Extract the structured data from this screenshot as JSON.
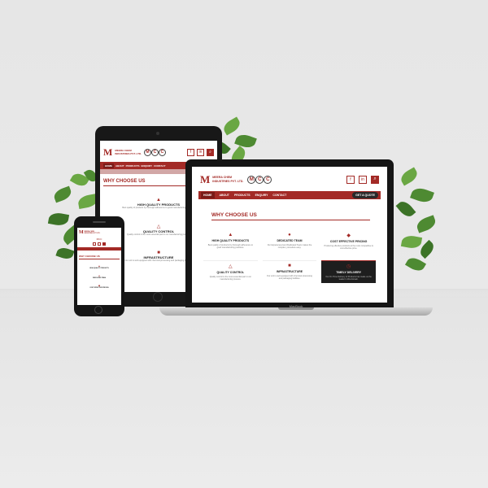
{
  "brand": {
    "logo_letter": "M",
    "company_line1": "MEERA CHEM",
    "company_line2": "INDUSTRIES PVT. LTD.",
    "mcc": [
      "M",
      "C",
      "C"
    ],
    "accent": "#a32a26",
    "dark_accent": "#7a1b18"
  },
  "social": {
    "facebook": "f",
    "linkedin": "in",
    "search": "⌕"
  },
  "nav": {
    "items": [
      "HOME",
      "ABOUT",
      "PRODUCTS",
      "ENQUIRY",
      "CONTACT"
    ],
    "quote": "GET A QUOTE"
  },
  "section_title": "WHY CHOOSE US",
  "features": [
    {
      "title": "HIGH QUALITY PRODUCTS",
      "desc": "Best quality of products by thorough adherence to good manufacturing practices.",
      "icon": "thumbs-up-icon"
    },
    {
      "title": "DEDICATED TEAM",
      "desc": "Our Experienced and Dedicated Team makes the complex, procedure easy.",
      "icon": "team-icon"
    },
    {
      "title": "COST EFFECTIVE PRICING",
      "desc": "Producing effective products at the most competitive & cost effective price.",
      "icon": "price-tag-icon"
    },
    {
      "title": "QUALITY CONTROL",
      "desc": "Quality control is the most essential part in our manufacturing process.",
      "icon": "flask-icon"
    },
    {
      "title": "INFRASTRUCTURE",
      "desc": "Our unit is well equipped with chemical processing and packaging facilities.",
      "icon": "factory-icon"
    },
    {
      "title": "TIMELY DELIVERY",
      "desc": "Our On Time Delivery of Products has made us the leader in this domain.",
      "icon": "clock-icon"
    }
  ],
  "tablet": {
    "features": [
      "HIGH QUALITY PRODUCTS",
      "QUALITY CONTROL",
      "INFRASTRUCTURE"
    ]
  },
  "laptop_brand": "MacBook"
}
